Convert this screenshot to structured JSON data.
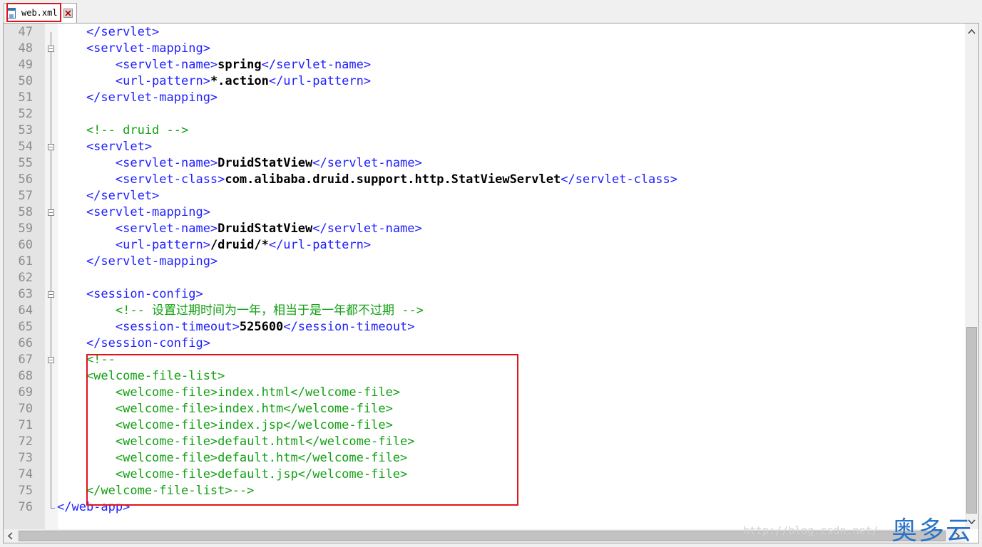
{
  "tab": {
    "filename": "web.xml"
  },
  "code_lines": [
    {
      "n": "47",
      "parts": [
        {
          "t": "tag",
          "s": "    </servlet>"
        }
      ]
    },
    {
      "n": "48",
      "parts": [
        {
          "t": "tag",
          "s": "    <servlet-mapping>"
        }
      ]
    },
    {
      "n": "49",
      "parts": [
        {
          "t": "tag",
          "s": "        <servlet-name>"
        },
        {
          "t": "txt",
          "s": "spring"
        },
        {
          "t": "tag",
          "s": "</servlet-name>"
        }
      ]
    },
    {
      "n": "50",
      "parts": [
        {
          "t": "tag",
          "s": "        <url-pattern>"
        },
        {
          "t": "txt",
          "s": "*.action"
        },
        {
          "t": "tag",
          "s": "</url-pattern>"
        }
      ]
    },
    {
      "n": "51",
      "parts": [
        {
          "t": "tag",
          "s": "    </servlet-mapping>"
        }
      ]
    },
    {
      "n": "52",
      "parts": []
    },
    {
      "n": "53",
      "parts": [
        {
          "t": "cmt",
          "s": "    <!-- druid -->"
        }
      ]
    },
    {
      "n": "54",
      "parts": [
        {
          "t": "tag",
          "s": "    <servlet>"
        }
      ]
    },
    {
      "n": "55",
      "parts": [
        {
          "t": "tag",
          "s": "        <servlet-name>"
        },
        {
          "t": "txt",
          "s": "DruidStatView"
        },
        {
          "t": "tag",
          "s": "</servlet-name>"
        }
      ]
    },
    {
      "n": "56",
      "parts": [
        {
          "t": "tag",
          "s": "        <servlet-class>"
        },
        {
          "t": "txt",
          "s": "com.alibaba.druid.support.http.StatViewServlet"
        },
        {
          "t": "tag",
          "s": "</servlet-class>"
        }
      ]
    },
    {
      "n": "57",
      "parts": [
        {
          "t": "tag",
          "s": "    </servlet>"
        }
      ]
    },
    {
      "n": "58",
      "parts": [
        {
          "t": "tag",
          "s": "    <servlet-mapping>"
        }
      ]
    },
    {
      "n": "59",
      "parts": [
        {
          "t": "tag",
          "s": "        <servlet-name>"
        },
        {
          "t": "txt",
          "s": "DruidStatView"
        },
        {
          "t": "tag",
          "s": "</servlet-name>"
        }
      ]
    },
    {
      "n": "60",
      "parts": [
        {
          "t": "tag",
          "s": "        <url-pattern>"
        },
        {
          "t": "txt",
          "s": "/druid/*"
        },
        {
          "t": "tag",
          "s": "</url-pattern>"
        }
      ]
    },
    {
      "n": "61",
      "parts": [
        {
          "t": "tag",
          "s": "    </servlet-mapping>"
        }
      ]
    },
    {
      "n": "62",
      "parts": []
    },
    {
      "n": "63",
      "parts": [
        {
          "t": "tag",
          "s": "    <session-config>"
        }
      ]
    },
    {
      "n": "64",
      "parts": [
        {
          "t": "cmt",
          "s": "        <!-- 设置过期时间为一年，相当于是一年都不过期 -->"
        }
      ]
    },
    {
      "n": "65",
      "parts": [
        {
          "t": "tag",
          "s": "        <session-timeout>"
        },
        {
          "t": "txt",
          "s": "525600"
        },
        {
          "t": "tag",
          "s": "</session-timeout>"
        }
      ]
    },
    {
      "n": "66",
      "parts": [
        {
          "t": "tag",
          "s": "    </session-config>"
        }
      ]
    },
    {
      "n": "67",
      "parts": [
        {
          "t": "cmt",
          "s": "    <!--"
        }
      ]
    },
    {
      "n": "68",
      "parts": [
        {
          "t": "cmt",
          "s": "    <welcome-file-list>"
        }
      ]
    },
    {
      "n": "69",
      "parts": [
        {
          "t": "cmt",
          "s": "        <welcome-file>index.html</welcome-file>"
        }
      ]
    },
    {
      "n": "70",
      "parts": [
        {
          "t": "cmt",
          "s": "        <welcome-file>index.htm</welcome-file>"
        }
      ]
    },
    {
      "n": "71",
      "parts": [
        {
          "t": "cmt",
          "s": "        <welcome-file>index.jsp</welcome-file>"
        }
      ]
    },
    {
      "n": "72",
      "parts": [
        {
          "t": "cmt",
          "s": "        <welcome-file>default.html</welcome-file>"
        }
      ]
    },
    {
      "n": "73",
      "parts": [
        {
          "t": "cmt",
          "s": "        <welcome-file>default.htm</welcome-file>"
        }
      ]
    },
    {
      "n": "74",
      "parts": [
        {
          "t": "cmt",
          "s": "        <welcome-file>default.jsp</welcome-file>"
        }
      ]
    },
    {
      "n": "75",
      "parts": [
        {
          "t": "cmt",
          "s": "    </welcome-file-list>-->"
        }
      ]
    },
    {
      "n": "76",
      "parts": [
        {
          "t": "tag",
          "s": "</web-app>"
        }
      ]
    }
  ],
  "fold_lines": [
    "48",
    "54",
    "58",
    "63",
    "67"
  ],
  "colors": {
    "tag": "#2020ff",
    "text": "#000000",
    "comment": "#13a013",
    "highlight": "#e0141b"
  },
  "watermark": {
    "url": "http://blog.csdn.net/",
    "brand": "奥多云"
  },
  "icons": {
    "file": "file-icon",
    "close": "close-icon",
    "scroll_up": "chevron-up-icon",
    "scroll_down": "chevron-down-icon",
    "scroll_left": "chevron-left-icon",
    "scroll_right": "chevron-right-icon"
  }
}
